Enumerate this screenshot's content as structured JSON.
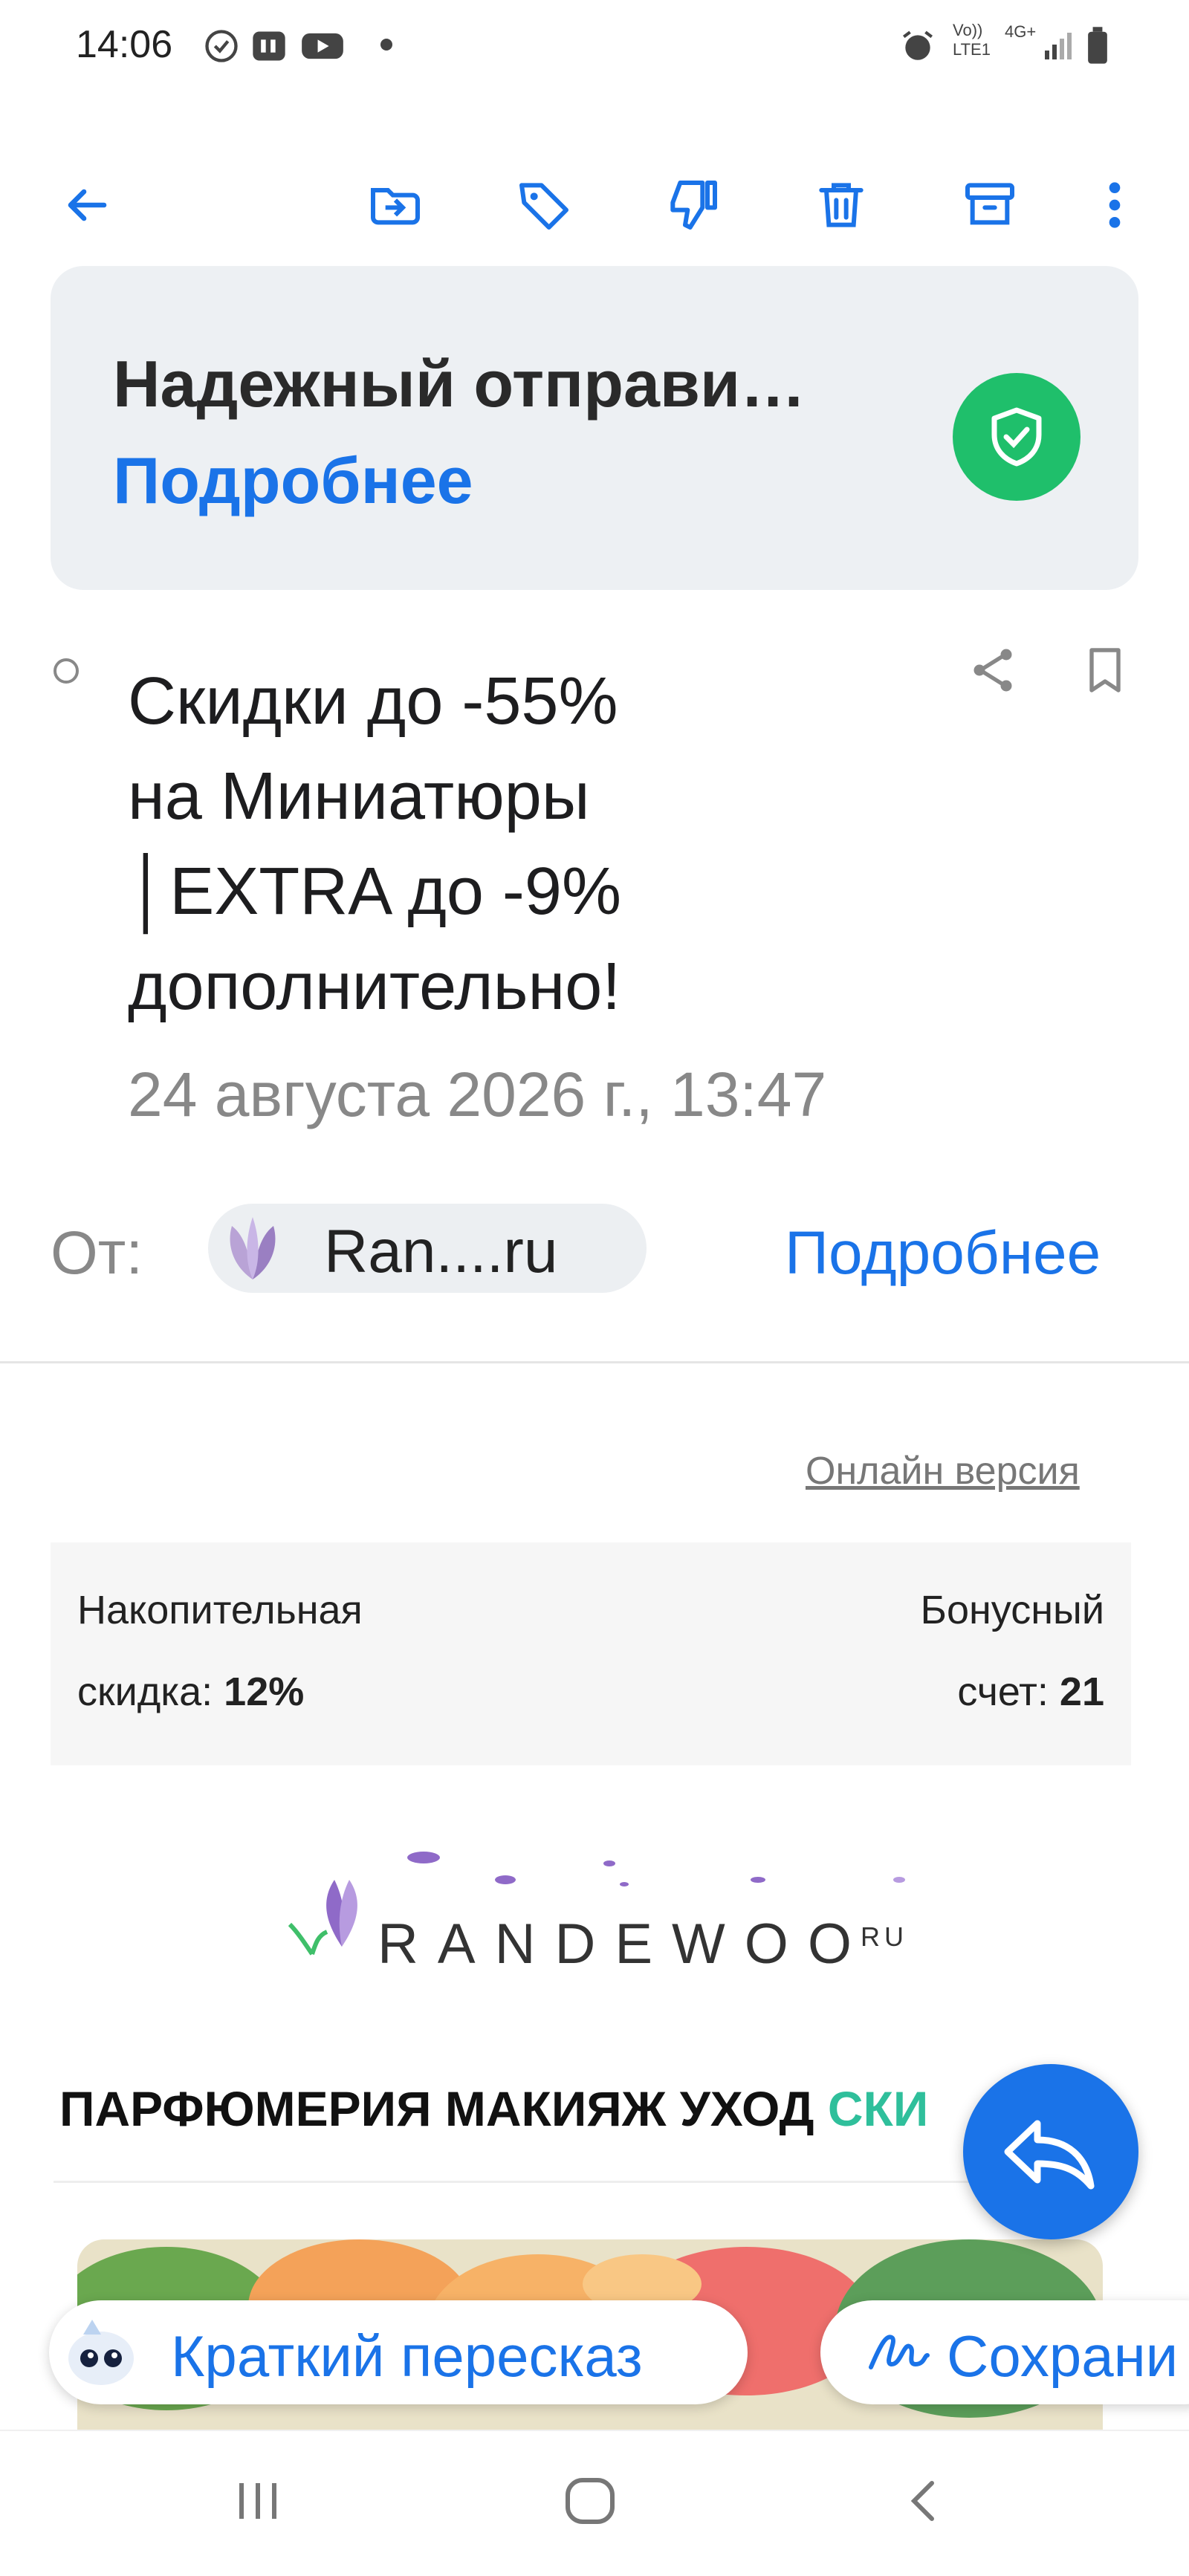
{
  "status_bar": {
    "time": "14:06",
    "network_text_1": "Vo))",
    "network_text_2": "LTE1",
    "network_gen": "4G+"
  },
  "toolbar": {
    "back_icon": "arrow-left",
    "icons": [
      "move-to-folder",
      "tag",
      "not-spam",
      "delete",
      "archive",
      "more-vertical"
    ]
  },
  "banner": {
    "title": "Надежный отправи…",
    "link": "Подробнее"
  },
  "email": {
    "subject_lines": [
      "Скидки до -55%",
      "на Миниатюры",
      "│EXTRA до -9%",
      "дополнительно!"
    ],
    "date": "24 августа 2026 г., 13:47",
    "from_label": "От:",
    "sender": "Ran....ru",
    "details_link": "Подробнее"
  },
  "body": {
    "online_version": "Онлайн версия",
    "loyalty": {
      "discount_label_1": "Накопительная",
      "discount_label_2": "скидка:",
      "discount_value": "12%",
      "bonus_label_1": "Бонусный",
      "bonus_label_2": "счет:",
      "bonus_value": "21"
    },
    "logo": "RANDEWOO",
    "logo_suffix": "RU",
    "nav": {
      "perfume": "ПАРФЮМЕРИЯ",
      "makeup": "МАКИЯЖ",
      "care": "УХОД",
      "sale": "СКИ"
    }
  },
  "chips": {
    "summary": "Краткий пересказ",
    "save": "Сохрани"
  },
  "colors": {
    "accent": "#1a73e8",
    "shield_green": "#1fbf6b",
    "sale_teal": "#2fbf9b",
    "banner_bg": "#edf0f3"
  }
}
